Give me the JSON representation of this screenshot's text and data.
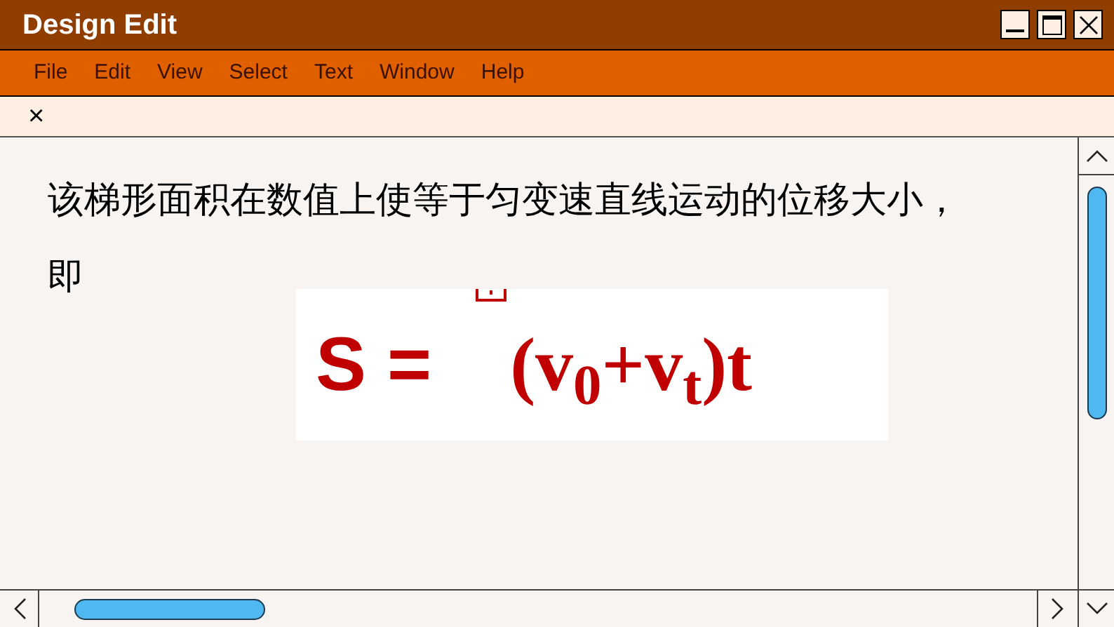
{
  "window": {
    "title": "Design Edit"
  },
  "menu": [
    "File",
    "Edit",
    "View",
    "Select",
    "Text",
    "Window",
    "Help"
  ],
  "tab_bar": {
    "close": "×"
  },
  "content": {
    "paragraph_lines": [
      "该梯形面积在数值上使等于匀变速直线运动的位移大小，",
      "即"
    ],
    "formula": {
      "lhs": "S =",
      "rhs": "(v$_{0}$+v$_{t}$)t"
    }
  }
}
